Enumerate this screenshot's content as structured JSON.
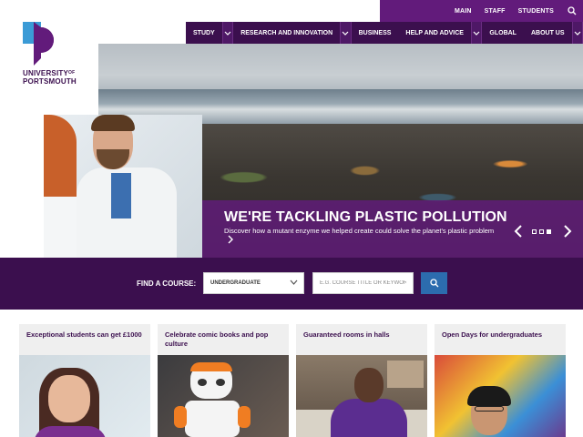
{
  "colors": {
    "brand_purple": "#621b7b",
    "dark_purple": "#3b0f4e",
    "search_blue": "#2c6cae",
    "card_bg": "#efefef"
  },
  "utility_nav": {
    "items": [
      "MAIN",
      "STAFF",
      "STUDENTS"
    ],
    "search_icon": "search-icon"
  },
  "main_nav": {
    "items": [
      {
        "label": "STUDY",
        "has_dropdown": true
      },
      {
        "label": "RESEARCH AND INNOVATION",
        "has_dropdown": true
      },
      {
        "label": "BUSINESS",
        "has_dropdown": false
      },
      {
        "label": "HELP AND ADVICE",
        "has_dropdown": true
      },
      {
        "label": "GLOBAL",
        "has_dropdown": false
      },
      {
        "label": "ABOUT US",
        "has_dropdown": true
      }
    ]
  },
  "logo": {
    "line1": "UNIVERSITY",
    "of": "OF",
    "line2": "PORTSMOUTH"
  },
  "hero": {
    "title": "WE'RE TACKLING PLASTIC POLLUTION",
    "subtitle": "Discover how a mutant enzyme we helped create could solve the planet's plastic problem",
    "more_icon": "chevron-right-icon",
    "slides_total": 3,
    "slide_active": 3
  },
  "course_finder": {
    "label": "FIND A COURSE:",
    "level_selected": "UNDERGRADUATE",
    "search_placeholder": "E.G. COURSE TITLE OR KEYWORD",
    "button_icon": "search-icon"
  },
  "cards": [
    {
      "title": "Exceptional students can get £1000"
    },
    {
      "title": "Celebrate comic books and pop culture"
    },
    {
      "title": "Guaranteed rooms in halls"
    },
    {
      "title": "Open Days for undergraduates"
    }
  ]
}
